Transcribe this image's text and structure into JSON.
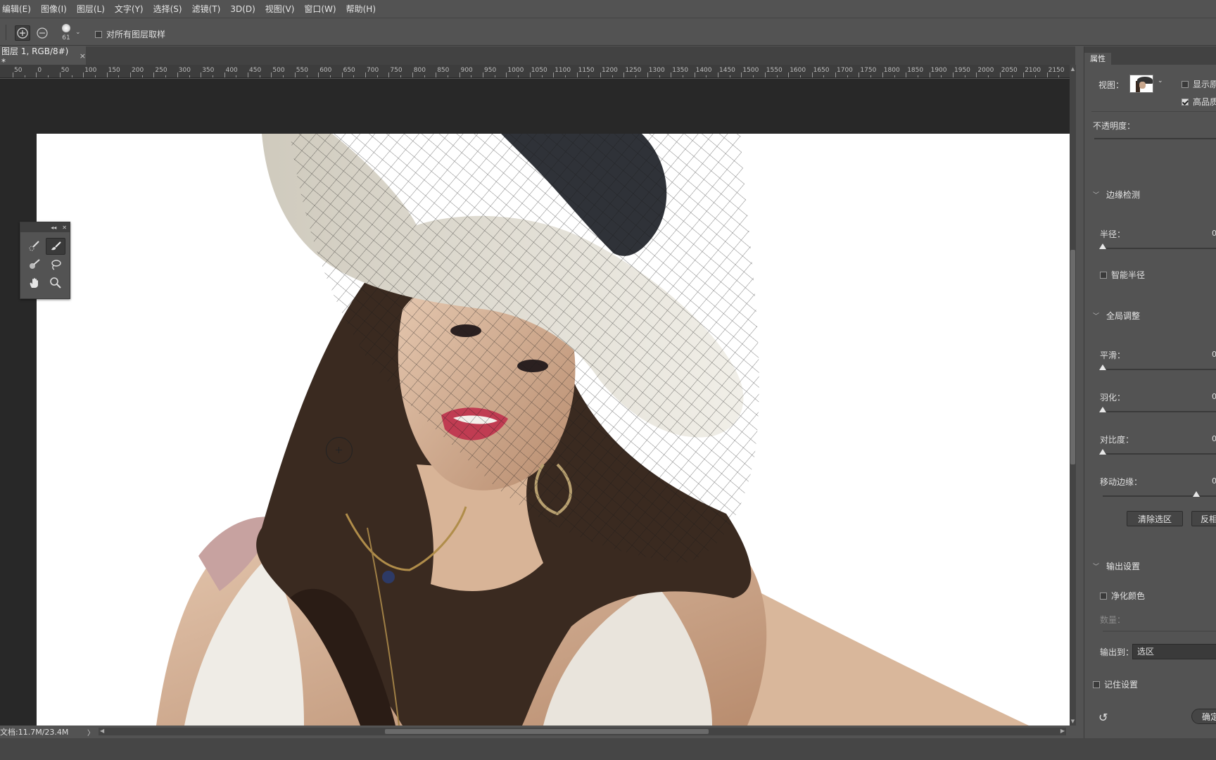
{
  "menu": [
    "编辑(E)",
    "图像(I)",
    "图层(L)",
    "文字(Y)",
    "选择(S)",
    "滤镜(T)",
    "3D(D)",
    "视图(V)",
    "窗口(W)",
    "帮助(H)"
  ],
  "options": {
    "brush_size": "61",
    "sample_all_layers": "对所有图层取样",
    "sample_all_checked": false
  },
  "document": {
    "tab_title": "图层 1, RGB/8#) *",
    "tab_close": "×",
    "status": "文档:11.7M/23.4M"
  },
  "ruler": {
    "labels": [
      "50",
      "0",
      "50",
      "100",
      "150",
      "200",
      "250",
      "300",
      "350",
      "400",
      "450",
      "500",
      "550",
      "600",
      "650",
      "700",
      "750",
      "800",
      "850",
      "900",
      "950",
      "1000",
      "1050",
      "1100",
      "1150",
      "1200",
      "1250",
      "1300",
      "1350",
      "1400",
      "1450",
      "1500",
      "1550",
      "1600",
      "1650",
      "1700",
      "1750",
      "1800",
      "1850",
      "1900",
      "1950",
      "2000",
      "2050",
      "2100",
      "2150"
    ]
  },
  "tool_panel": {
    "tools": [
      "quick-selection-brush-icon",
      "refine-edge-brush-icon",
      "brush-icon",
      "lasso-icon",
      "hand-icon",
      "zoom-icon"
    ]
  },
  "properties": {
    "tab": "属性",
    "view_label": "视图：",
    "show_original": "显示原",
    "high_quality": "高品质",
    "show_original_checked": false,
    "high_quality_checked": true,
    "opacity_label": "不透明度：",
    "edge_detection": {
      "title": "边缘检测",
      "radius_label": "半径：",
      "radius_value": "0",
      "smart_radius": "智能半径"
    },
    "global_refine": {
      "title": "全局调整",
      "smooth_label": "平滑：",
      "smooth_value": "0",
      "feather_label": "羽化：",
      "feather_value": "0",
      "contrast_label": "对比度：",
      "contrast_value": "0",
      "shift_edge_label": "移动边缘：",
      "shift_edge_value": "0",
      "clear_selection": "清除选区",
      "invert": "反相"
    },
    "output": {
      "title": "输出设置",
      "decontaminate": "净化颜色",
      "amount_label": "数量：",
      "output_to_label": "输出到：",
      "output_to_value": "选区",
      "remember": "记住设置",
      "ok": "确定"
    }
  },
  "colors": {
    "ui_bg": "#535353",
    "canvas_bg": "#282828",
    "canvas_white": "#ffffff"
  }
}
